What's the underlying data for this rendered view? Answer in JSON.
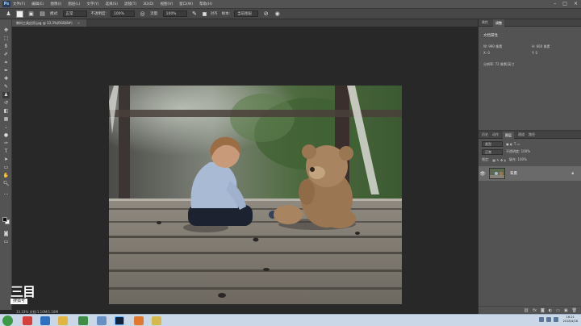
{
  "menubar": {
    "items": [
      "文件(F)",
      "编辑(E)",
      "图像(I)",
      "图层(L)",
      "文字(Y)",
      "选择(S)",
      "滤镜(T)",
      "3D(D)",
      "视图(V)",
      "窗口(W)",
      "帮助(H)"
    ]
  },
  "options": {
    "mode_label": "模式:",
    "mode_value": "正常",
    "opacity_label": "不透明度:",
    "opacity_value": "100%",
    "flow_label": "流量:",
    "flow_value": "100%",
    "align_label": "对齐",
    "sample_label": "样本:",
    "sample_value": "当前图层"
  },
  "document": {
    "tab_label": "教科工具应用.jpg @ 33.3%(RGB/8#)",
    "status": "33.33%    文档:1.10M/1.10M"
  },
  "properties": {
    "tabs": [
      "属性",
      "调整"
    ],
    "title": "文档属性",
    "w": "W: 990 像素",
    "h": "H: 660 像素",
    "x": "X: 0",
    "y": "Y: 0",
    "resolution": "分辨率: 72 像素/英寸"
  },
  "layers": {
    "tabs": [
      "历史",
      "动作",
      "图层",
      "通道",
      "路径"
    ],
    "kind_label": "类型",
    "blend_mode": "正常",
    "opacity_label": "不透明度: 100%",
    "lock_label": "锁定:",
    "fill_label": "填充: 100%",
    "layer_name": "背景"
  },
  "watermark": {
    "logo": "三目",
    "sub": "搜狐号"
  },
  "taskbar": {
    "time": "16:21",
    "date": "2018/4/28"
  },
  "icons": [
    "move-icon",
    "marquee-icon",
    "lasso-icon",
    "quick-select-icon",
    "crop-icon",
    "eyedropper-icon",
    "healing-icon",
    "brush-icon",
    "stamp-icon",
    "history-brush-icon",
    "eraser-icon",
    "gradient-icon",
    "blur-icon",
    "dodge-icon",
    "pen-icon",
    "type-icon",
    "path-select-icon",
    "shape-icon",
    "hand-icon",
    "zoom-icon"
  ],
  "colors": {
    "app_bg": "#282828",
    "panel_bg": "#535353",
    "taskbar": "#c9d7e6"
  }
}
